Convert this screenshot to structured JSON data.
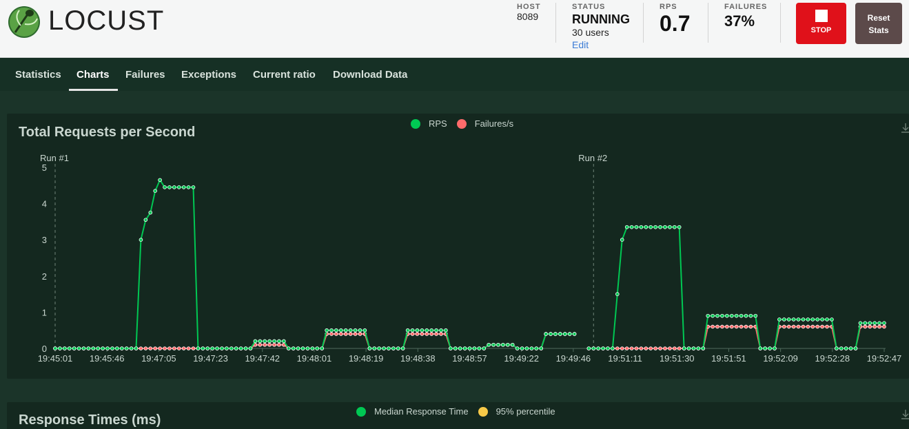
{
  "header": {
    "logo_text": "LOCUST",
    "host": {
      "label": "HOST",
      "value": "8089"
    },
    "status": {
      "label": "STATUS",
      "value": "RUNNING",
      "users": "30 users",
      "edit": "Edit"
    },
    "rps": {
      "label": "RPS",
      "value": "0.7"
    },
    "failures": {
      "label": "FAILURES",
      "value": "37%"
    },
    "stop_label": "STOP",
    "reset_label_1": "Reset",
    "reset_label_2": "Stats"
  },
  "tabs": [
    "Statistics",
    "Charts",
    "Failures",
    "Exceptions",
    "Current ratio",
    "Download Data"
  ],
  "active_tab": "Charts",
  "colors": {
    "rps": "#00c853",
    "failures": "#ff6b6b",
    "median": "#00c853",
    "p95": "#f7c948",
    "brand_stop": "#e0111a"
  },
  "chart_data": [
    {
      "type": "line",
      "title": "Total Requests per Second",
      "legend": [
        "RPS",
        "Failures/s"
      ],
      "legend_position": "top-center",
      "ylim": [
        0,
        5
      ],
      "yticks": [
        0,
        1,
        2,
        3,
        4,
        5
      ],
      "x_ticks": [
        "19:45:01",
        "19:45:46",
        "19:47:05",
        "19:47:23",
        "19:47:42",
        "19:48:01",
        "19:48:19",
        "19:48:38",
        "19:48:57",
        "19:49:22",
        "19:49:46",
        "19:51:11",
        "19:51:30",
        "19:51:51",
        "19:52:09",
        "19:52:28",
        "19:52:47"
      ],
      "markers": [
        {
          "label": "Run #1",
          "at_point": 0
        },
        {
          "label": "Run #2",
          "at_point": 113
        }
      ],
      "series": [
        {
          "name": "RPS",
          "values": [
            0,
            0,
            0,
            0,
            0,
            0,
            0,
            0,
            0,
            0,
            0,
            0,
            0,
            0,
            0,
            0,
            0,
            0,
            3,
            3.55,
            3.75,
            4.35,
            4.65,
            4.45,
            4.45,
            4.45,
            4.45,
            4.45,
            4.45,
            4.45,
            0,
            0,
            0,
            0,
            0,
            0,
            0,
            0,
            0,
            0,
            0,
            0,
            0.2,
            0.2,
            0.2,
            0.2,
            0.2,
            0.2,
            0.2,
            0,
            0,
            0,
            0,
            0,
            0,
            0,
            0,
            0.5,
            0.5,
            0.5,
            0.5,
            0.5,
            0.5,
            0.5,
            0.5,
            0.5,
            0,
            0,
            0,
            0,
            0,
            0,
            0,
            0,
            0.5,
            0.5,
            0.5,
            0.5,
            0.5,
            0.5,
            0.5,
            0.5,
            0.5,
            0,
            0,
            0,
            0,
            0,
            0,
            0,
            0,
            0.1,
            0.1,
            0.1,
            0.1,
            0.1,
            0.1,
            0,
            0,
            0,
            0,
            0,
            0,
            0.4,
            0.4,
            0.4,
            0.4,
            0.4,
            0.4,
            0.4,
            null,
            null,
            0,
            0,
            0,
            0,
            0,
            0,
            1.5,
            3,
            3.35,
            3.35,
            3.35,
            3.35,
            3.35,
            3.35,
            3.35,
            3.35,
            3.35,
            3.35,
            3.35,
            3.35,
            0,
            0,
            0,
            0,
            0,
            0.9,
            0.9,
            0.9,
            0.9,
            0.9,
            0.9,
            0.9,
            0.9,
            0.9,
            0.9,
            0.9,
            0,
            0,
            0,
            0,
            0.8,
            0.8,
            0.8,
            0.8,
            0.8,
            0.8,
            0.8,
            0.8,
            0.8,
            0.8,
            0.8,
            0.8,
            0,
            0,
            0,
            0,
            0,
            0.7,
            0.7,
            0.7,
            0.7,
            0.7,
            0.7
          ]
        },
        {
          "name": "Failures/s",
          "values": [
            0,
            0,
            0,
            0,
            0,
            0,
            0,
            0,
            0,
            0,
            0,
            0,
            0,
            0,
            0,
            0,
            0,
            0,
            0,
            0,
            0,
            0,
            0,
            0,
            0,
            0,
            0,
            0,
            0,
            0,
            0,
            0,
            0,
            0,
            0,
            0,
            0,
            0,
            0,
            0,
            0,
            0,
            0.1,
            0.1,
            0.1,
            0.1,
            0.1,
            0.1,
            0.1,
            0,
            0,
            0,
            0,
            0,
            0,
            0,
            0,
            0.4,
            0.4,
            0.4,
            0.4,
            0.4,
            0.4,
            0.4,
            0.4,
            0.4,
            0,
            0,
            0,
            0,
            0,
            0,
            0,
            0,
            0.4,
            0.4,
            0.4,
            0.4,
            0.4,
            0.4,
            0.4,
            0.4,
            0.4,
            0,
            0,
            0,
            0,
            0,
            0,
            0,
            0,
            0.1,
            0.1,
            0.1,
            0.1,
            0.1,
            0.1,
            0,
            0,
            0,
            0,
            0,
            0,
            0.4,
            0.4,
            0.4,
            0.4,
            0.4,
            0.4,
            0.4,
            null,
            null,
            0,
            0,
            0,
            0,
            0,
            0,
            0,
            0,
            0,
            0,
            0,
            0,
            0,
            0,
            0,
            0,
            0,
            0,
            0,
            0,
            0,
            0,
            0,
            0,
            0,
            0.6,
            0.6,
            0.6,
            0.6,
            0.6,
            0.6,
            0.6,
            0.6,
            0.6,
            0.6,
            0.6,
            0,
            0,
            0,
            0,
            0.6,
            0.6,
            0.6,
            0.6,
            0.6,
            0.6,
            0.6,
            0.6,
            0.6,
            0.6,
            0.6,
            0.6,
            0,
            0,
            0,
            0,
            0,
            0.6,
            0.6,
            0.6,
            0.6,
            0.6,
            0.6
          ]
        }
      ]
    },
    {
      "type": "line",
      "title": "Response Times (ms)",
      "legend": [
        "Median Response Time",
        "95% percentile"
      ],
      "legend_position": "top-center"
    }
  ]
}
